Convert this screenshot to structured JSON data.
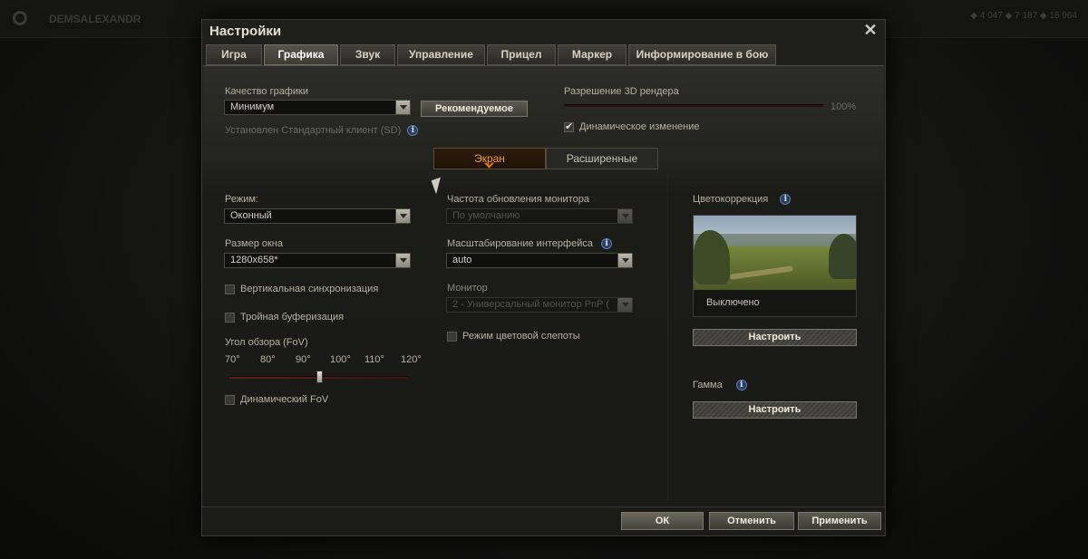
{
  "window": {
    "title": "Настройки",
    "close_glyph": "✕"
  },
  "background": {
    "player_name": "DEMSALEXANDR",
    "stats": "◆ 4 047 ◆ 7 187 ◆ 18 964"
  },
  "tabs": [
    {
      "label": "Игра",
      "active": false
    },
    {
      "label": "Графика",
      "active": true
    },
    {
      "label": "Звук",
      "active": false
    },
    {
      "label": "Управление",
      "active": false
    },
    {
      "label": "Прицел",
      "active": false
    },
    {
      "label": "Маркер",
      "active": false
    },
    {
      "label": "Информирование в бою",
      "active": false
    }
  ],
  "quality": {
    "label": "Качество графики",
    "value": "Минимум",
    "recommended_button": "Рекомендуемое",
    "client_note": "Установлен Стандартный клиент (SD)"
  },
  "render": {
    "label": "Разрешение 3D рендера",
    "value": "100%",
    "level": 1.0,
    "dynamic_label": "Динамическое изменение",
    "dynamic_checked": true
  },
  "subtabs": [
    {
      "label": "Экран",
      "active": true
    },
    {
      "label": "Расширенные",
      "active": false
    }
  ],
  "screen": {
    "mode_label": "Режим:",
    "mode_value": "Оконный",
    "window_size_label": "Размер окна",
    "window_size_value": "1280x658*",
    "vsync_label": "Вертикальная синхронизация",
    "vsync_checked": false,
    "triple_label": "Тройная буферизация",
    "triple_checked": false,
    "fov_label": "Угол обзора (FoV)",
    "fov_ticks": [
      "70°",
      "80°",
      "90°",
      "100°",
      "110°",
      "120°"
    ],
    "fov_value": 95,
    "dynamic_fov_label": "Динамический FoV",
    "dynamic_fov_checked": false,
    "refresh_label": "Частота обновления монитора",
    "refresh_value": "По умолчанию",
    "scaling_label": "Масштабирование интерфейса",
    "scaling_value": "auto",
    "monitor_label": "Монитор",
    "monitor_value": "2 - Универсальный монитор PnP (",
    "colorblind_label": "Режим цветовой слепоты",
    "colorblind_checked": false
  },
  "color": {
    "label": "Цветокоррекция",
    "preview_caption": "Выключено",
    "configure_button": "Настроить",
    "gamma_label": "Гамма",
    "gamma_button": "Настроить"
  },
  "footer": {
    "ok": "ОК",
    "cancel": "Отменить",
    "apply": "Применить"
  },
  "info_glyph": "i"
}
